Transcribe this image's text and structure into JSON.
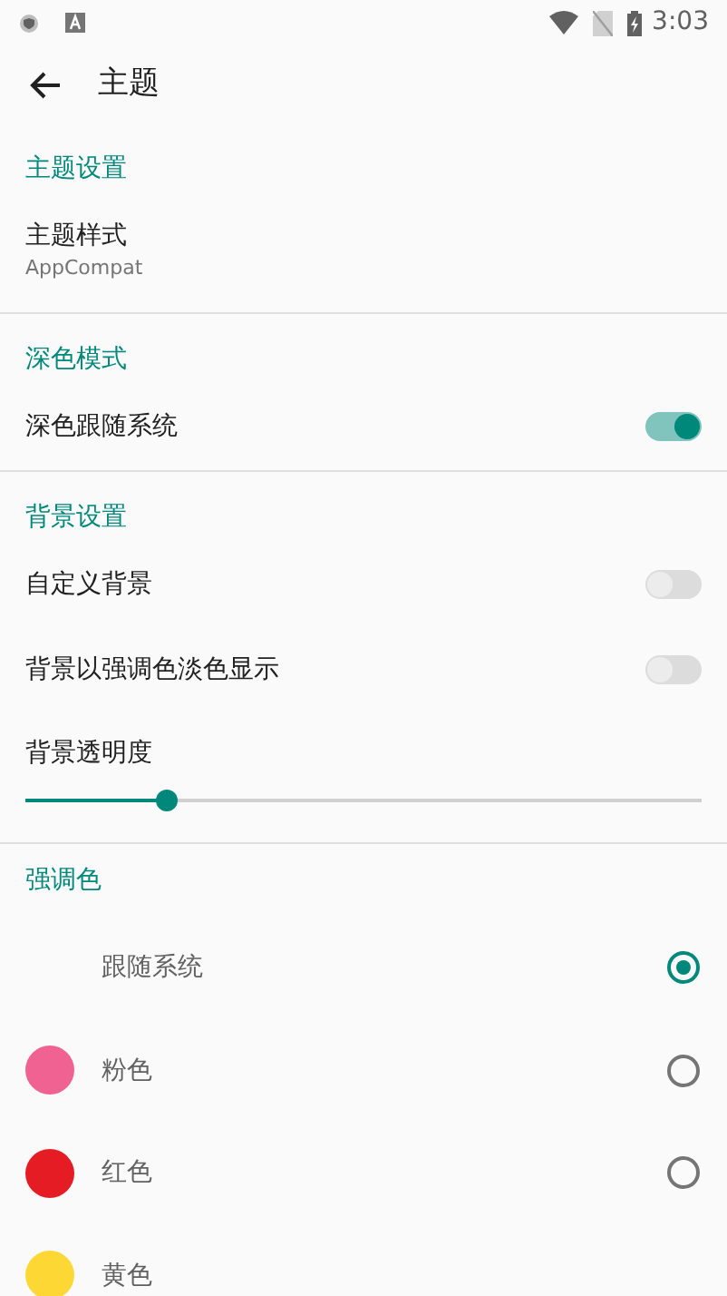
{
  "status_bar": {
    "time": "3:03"
  },
  "toolbar": {
    "title": "主题"
  },
  "sections": [
    {
      "header": "主题设置",
      "items": [
        {
          "kind": "text",
          "title": "主题样式",
          "subtitle": "AppCompat"
        }
      ]
    },
    {
      "header": "深色模式",
      "items": [
        {
          "kind": "switch",
          "title": "深色跟随系统",
          "on": true
        }
      ]
    },
    {
      "header": "背景设置",
      "items": [
        {
          "kind": "switch",
          "title": "自定义背景",
          "on": false
        },
        {
          "kind": "switch",
          "title": "背景以强调色淡色显示",
          "on": false
        },
        {
          "kind": "slider",
          "title": "背景透明度",
          "level": 0.21
        }
      ]
    },
    {
      "header": "强调色",
      "items": [
        {
          "kind": "color",
          "title": "跟随系统",
          "selected": true
        },
        {
          "kind": "color",
          "title": "粉色",
          "color": "#f06292",
          "selected": false
        },
        {
          "kind": "color",
          "title": "红色",
          "color": "#e51c23",
          "selected": false
        },
        {
          "kind": "color",
          "title": "黄色",
          "color": "#fdd835"
        }
      ]
    }
  ]
}
